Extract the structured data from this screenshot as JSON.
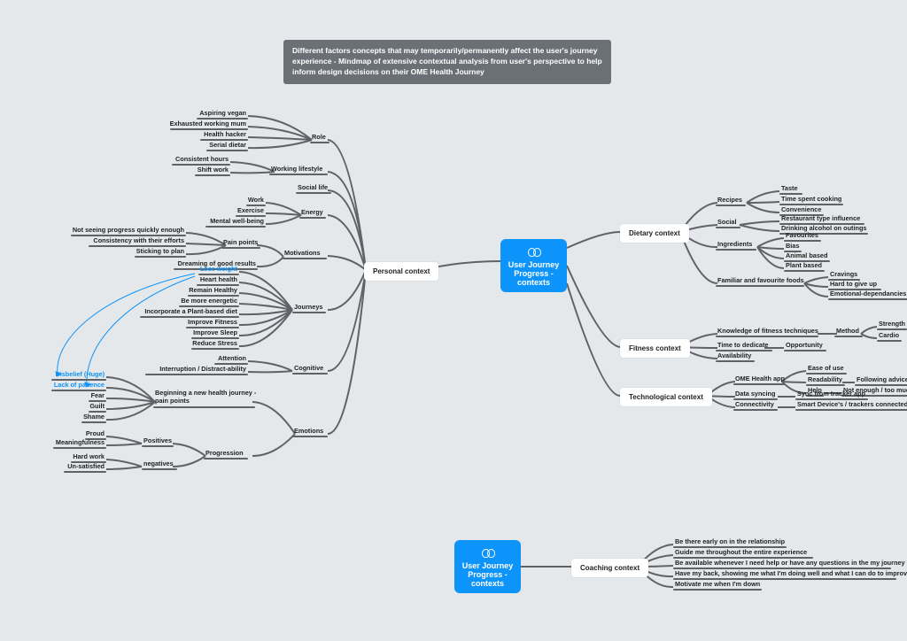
{
  "banner": "Different factors concepts that may temporarily/permanently affect the user's journey experience\n- Mindmap of extensive contextual analysis from user's perspective to help inform design\ndecisions on their OME Health Journey",
  "center1": "User Journey\nProgress -\ncontexts",
  "center2": "User Journey\nProgress -\ncontexts",
  "ctx": {
    "personal": "Personal context",
    "dietary": "Dietary context",
    "fitness": "Fitness context",
    "technological": "Technological context",
    "coaching": "Coaching context"
  },
  "personal": {
    "role": {
      "label": "Role",
      "items": [
        "Aspiring vegan",
        "Exhausted working mum",
        "Health hacker",
        "Serial dietar"
      ]
    },
    "working": {
      "label": "Working lifestyle",
      "items": [
        "Consistent hours",
        "Shift work"
      ]
    },
    "social": {
      "label": "Social life"
    },
    "energy": {
      "label": "Energy",
      "items": [
        "Work",
        "Exercise",
        "Mental well-being"
      ]
    },
    "motivations": {
      "label": "Motivations"
    },
    "painpoints": {
      "label": "Pain points",
      "items": [
        "Not seeing progress quickly enough",
        "Consistency with their efforts",
        "Sticking to plan"
      ]
    },
    "dreaming": "Dreaming of good results",
    "journeys": {
      "label": "Journeys",
      "items": [
        "Lose weight",
        "Heart health",
        "Remain Healthy",
        "Be more energetic",
        "Incorporate a Plant-based diet",
        "Improve Fitness",
        "Improve Sleep",
        "Reduce Stress"
      ]
    },
    "cognitive": {
      "label": "Cognitive",
      "items": [
        "Attention",
        "Interruption / Distract-ability"
      ]
    },
    "emotions": {
      "label": "Emotions"
    },
    "beginning": {
      "label": "Beginning a new health journey -\npain points",
      "items": [
        "Disbelief (Huge)",
        "Lack of patience",
        "Fear",
        "Guilt",
        "Shame"
      ]
    },
    "progression": {
      "label": "Progression"
    },
    "positives": {
      "label": "Positives",
      "items": [
        "Proud",
        "Meaningfulness"
      ]
    },
    "negatives": {
      "label": "negatives",
      "items": [
        "Hard work",
        "Un-satisfied"
      ]
    }
  },
  "dietary": {
    "recipes": {
      "label": "Recipes",
      "items": [
        "Taste",
        "Time spent cooking",
        "Convenience"
      ]
    },
    "social": {
      "label": "Social",
      "items": [
        "Restaurant type influence",
        "Drinking alcohol on outings"
      ]
    },
    "ingredients": {
      "label": "Ingredients",
      "items": [
        "Favourites",
        "Bias",
        "Animal based",
        "Plant based"
      ]
    },
    "familiar": {
      "label": "Familiar and favourite foods",
      "items": [
        "Cravings",
        "Hard to give up",
        "Emotional-dependancies"
      ]
    }
  },
  "fitness": {
    "method": {
      "label": "Method",
      "pre": "Knowledge of fitness techniques",
      "items": [
        "Strength",
        "Cardio"
      ]
    },
    "opportunity": {
      "label": "Opportunity",
      "pre": "Time to dedicate"
    },
    "availability": "Availability"
  },
  "technological": {
    "app": {
      "label": "OME Health app",
      "ease": "Ease of use",
      "readability": "Readability",
      "following": "Following advice",
      "help": "Help",
      "notenough": "Not enough / too much information"
    },
    "sync": {
      "label": "Data syncing",
      "val": "Sync from tracker app"
    },
    "connectivity": {
      "label": "Connectivity",
      "val": "Smart Device's / trackers connected"
    }
  },
  "coaching": [
    "Be there early on in the relationship",
    "Guide me throughout the entire experience",
    "Be available whenever I need help or have any questions in the my journey",
    "Have my back, showing me what I'm doing well and what I can do to improve",
    "Motivate me when I'm down"
  ]
}
